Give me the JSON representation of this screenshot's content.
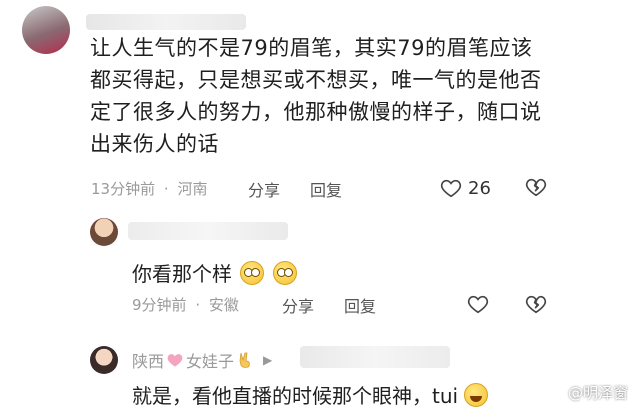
{
  "comment1": {
    "text_lines": [
      "让人生气的不是79的眉笔，其实79的眉笔应该",
      "都买得起，只是想买或不想买，唯一气的是他否",
      "定了很多人的努力，他那种傲慢的样子，随口说",
      "出来伤人的话"
    ],
    "time": "13分钟前",
    "sep": "·",
    "location": "河南",
    "share_label": "分享",
    "reply_label": "回复",
    "like_count": "26"
  },
  "comment2": {
    "text": "你看那个样",
    "time": "9分钟前",
    "sep": "·",
    "location": "安徽",
    "share_label": "分享",
    "reply_label": "回复"
  },
  "comment3": {
    "name_part1": "陕西",
    "name_part2": "女娃子",
    "text": "就是，看他直播的时候那个眼神，tui"
  },
  "watermark": "@明泽窗",
  "colors": {
    "text": "#1f1f1f",
    "meta": "#9a9a9a",
    "heart_pink": "#f4a3c0"
  }
}
